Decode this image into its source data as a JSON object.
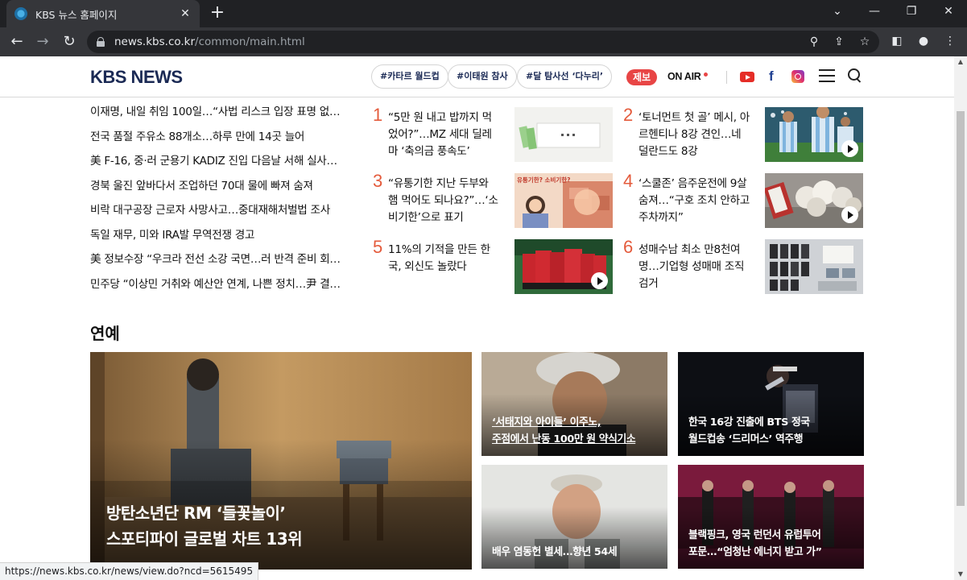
{
  "browser": {
    "tab_title": "KBS 뉴스 홈페이지",
    "tab_close": "✕",
    "new_tab": "+",
    "url_host": "news.kbs.co.kr",
    "url_path": "/common/main.html",
    "status_url": "https://news.kbs.co.kr/news/view.do?ncd=5615495"
  },
  "header": {
    "logo": "KBS NEWS",
    "hashtags": [
      "#카타르 월드컵",
      "#이태원 참사",
      "#달 탐사선 ‘다누리’"
    ],
    "report_badge": "제보",
    "on_air": "ON AIR",
    "social": [
      "youtube-icon",
      "facebook-icon",
      "instagram-icon"
    ]
  },
  "news_list": [
    "이재명, 내일 취임 100일…“사법 리스크 입장 표명 없…",
    "전국 품절 주유소 88개소…하루 만에 14곳 늘어",
    "美 F-16, 중·러 군용기 KADIZ 진입 다음날 서해 실사…",
    "경북 울진 앞바다서 조업하던 70대 물에 빠져 숨져",
    "비락 대구공장 근로자 사망사고…중대재해처벌법 조사",
    "독일 재무, 미와 IRA발 무역전쟁 경고",
    "美 정보수장 “우크라 전선 소강 국면…러 반격 준비 회…",
    "민주당 “이상민 거취와 예산안 연계, 나쁜 정치…尹 결…"
  ],
  "ranking": [
    {
      "num": "1",
      "title": "“5만 원 내고 밥까지 먹었어?”…MZ 세대 딜레마 ‘축의금 풍속도’",
      "video": false
    },
    {
      "num": "2",
      "title": "‘토너먼트 첫 골’ 메시, 아르헨티나 8강 견인…네덜란드도 8강",
      "video": true
    },
    {
      "num": "3",
      "title": "“유통기한 지난 두부와 햄 먹어도 되나요?”…‘소비기한’으로 표기",
      "video": false
    },
    {
      "num": "4",
      "title": "‘스쿨존’ 음주운전에 9살 숨져…“구호 조치 안하고 주차까지”",
      "video": true
    },
    {
      "num": "5",
      "title": "11%의 기적을 만든 한국, 외신도 놀랐다",
      "video": true
    },
    {
      "num": "6",
      "title": "성매수남 최소 만8천여 명…기업형 성매매 조직 검거",
      "video": false
    }
  ],
  "rank3_thumb_text": "유통기한? 소비기한?",
  "entertainment": {
    "title": "연예",
    "featured": {
      "line1": "방탄소년단 RM ‘들꽃놀이’",
      "line2": "스포티파이 글로벌 차트 13위"
    },
    "cards": [
      {
        "line1": "‘서태지와 아이들’ 이주노,",
        "line2": "주점에서 난동 100만 원 약식기소"
      },
      {
        "line1": "한국 16강 진출에 BTS 정국",
        "line2": "월드컵송 ‘드리머스’ 역주행"
      },
      {
        "line1": "배우 염동헌 별세…향년 54세",
        "line2": ""
      },
      {
        "line1": "블랙핑크, 영국 런던서 유럽투어",
        "line2": "포문…“엄청난 에너지 받고 가”"
      }
    ]
  }
}
